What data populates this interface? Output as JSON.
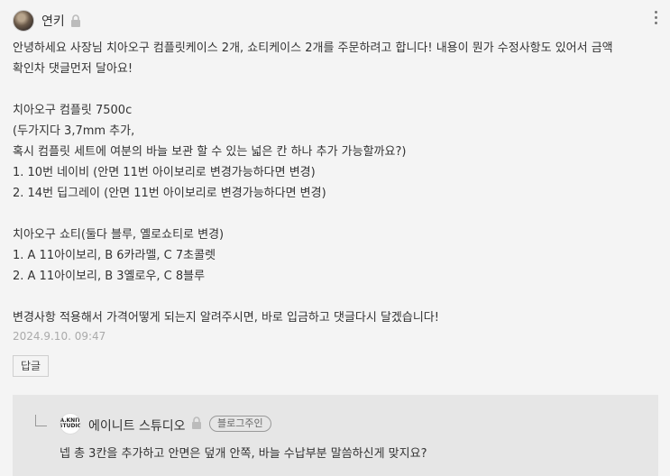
{
  "comment": {
    "author": "연키",
    "body": "안녕하세요 사장님 치아오구 컴플릿케이스 2개, 쇼티케이스 2개를 주문하려고 합니다! 내용이 뭔가 수정사항도 있어서 금액\n확인차 댓글먼저 달아요!\n\n치아오구 컴플릿 7500c\n(두가지다 3,7mm 추가,\n혹시 컴플릿 세트에 여분의 바늘 보관 할 수 있는 넓은 칸 하나 추가 가능할까요?)\n1. 10번 네이비 (안면 11번 아이보리로 변경가능하다면 변경)\n2. 14번 딥그레이 (안면 11번 아이보리로 변경가능하다면 변경)\n\n치아오구 쇼티(둘다 블루, 옐로쇼티로 변경)\n1. A 11아이보리, B 6카라멜, C 7초콜렛\n2. A 11아이보리, B 3옐로우, C 8블루\n\n변경사항 적용해서 가격어떻게 되는지 알려주시면, 바로 입금하고 댓글다시 달겠습니다!",
    "date": "2024.9.10. 09:47",
    "reply_label": "답글"
  },
  "reply": {
    "avatar_text": "A.KNIT STUDIO",
    "author": "에이니트 스튜디오",
    "badge": "블로그주인",
    "text": "넵 총 3칸을 추가하고 안면은 덮개 안쪽, 바늘 수납부분 말씀하신게 맞지요?"
  },
  "icons": {
    "lock": "lock-icon",
    "more": "more-vertical-icon",
    "reply_arrow": "reply-arrow-icon"
  }
}
